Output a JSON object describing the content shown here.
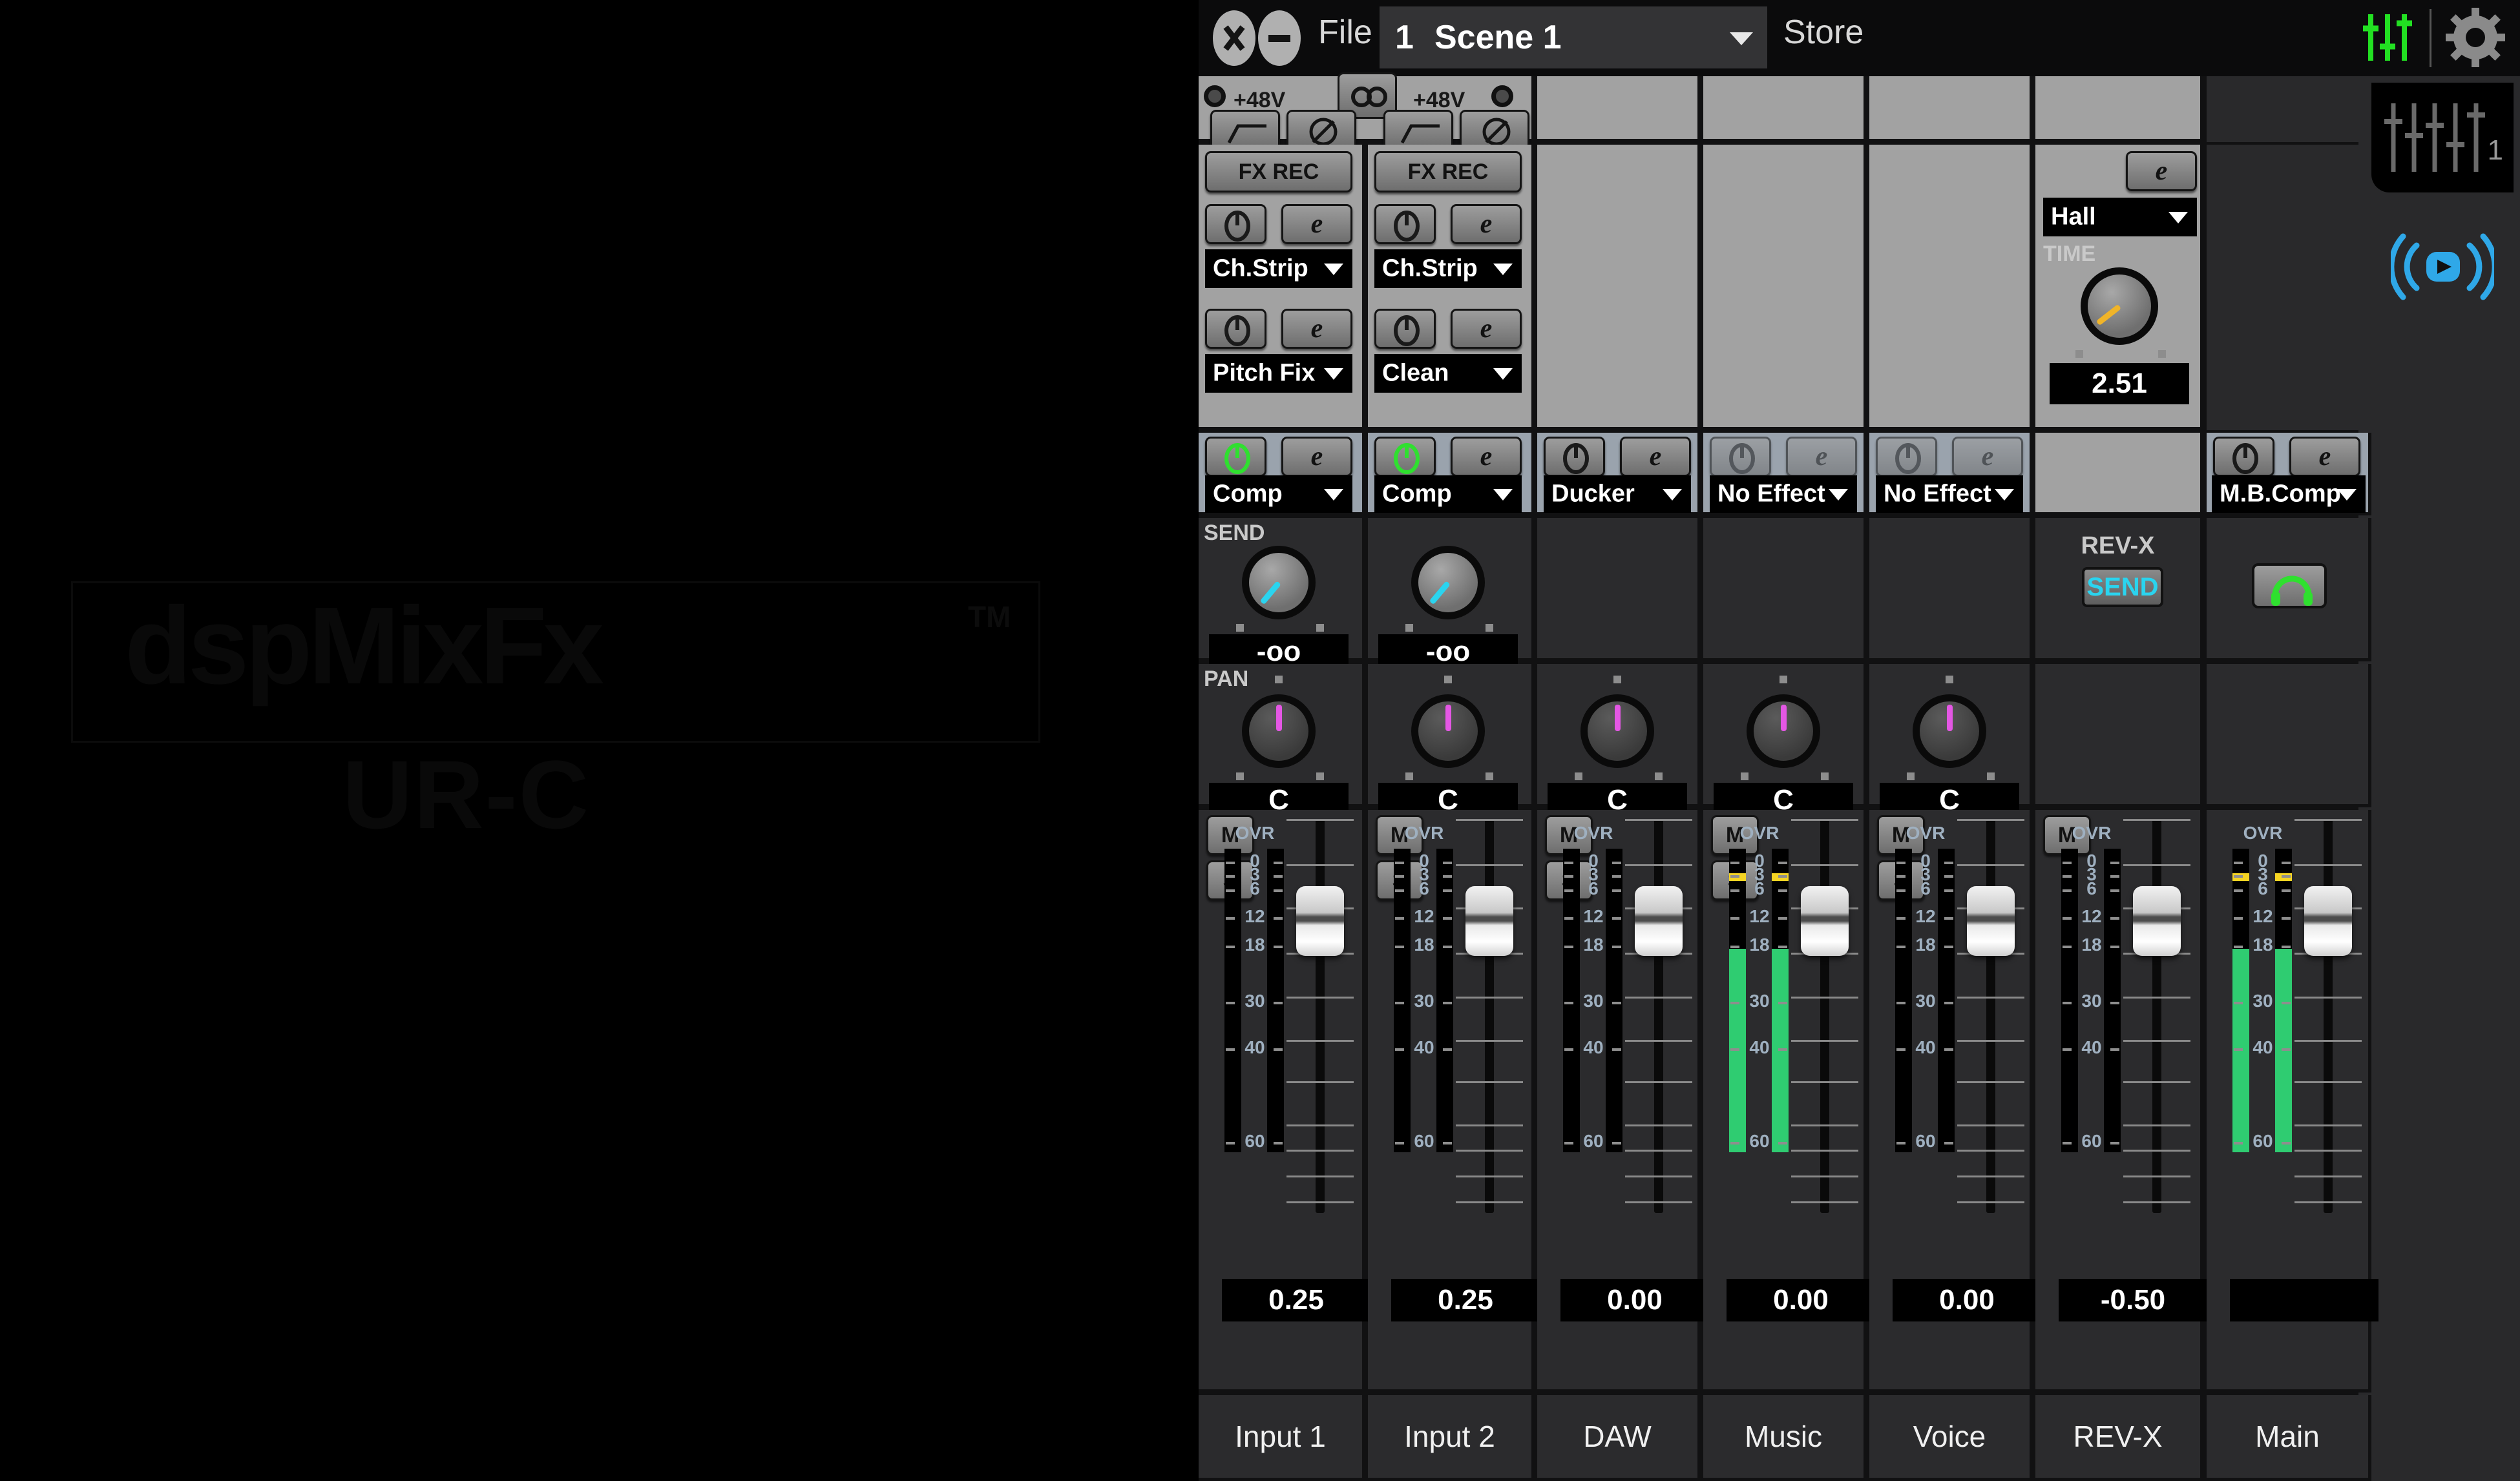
{
  "app": {
    "logo_text": "dspMixFx",
    "logo_tm": "TM",
    "logo_sub": "UR-C"
  },
  "header": {
    "close_icon": "close-icon",
    "minimize_icon": "minimize-icon",
    "file_label": "File",
    "scene_number": "1",
    "scene_name": "Scene 1",
    "store_label": "Store",
    "eq_icon": "faders-icon",
    "gear_icon": "gear-icon"
  },
  "rail": {
    "mixer_tab_number": "1",
    "mixer_tab_icon": "mixer-faders-icon",
    "stream_icon": "broadcast-icon"
  },
  "input_pair": {
    "phantom_left_label": "+48V",
    "phantom_right_label": "+48V",
    "link_icon": "link-icon",
    "hpf_icon": "highpass-filter-icon",
    "phase_icon": "phase-invert-icon"
  },
  "channels": [
    {
      "name": "Input 1",
      "fx_rec_label": "FX REC",
      "chstrip_value": "Ch.Strip",
      "chstrip_on": false,
      "amp_value": "Pitch Fix",
      "amp_on": false,
      "effect_value": "Comp",
      "effect_on": true,
      "effect_enabled": true,
      "send_label": "SEND",
      "send_value": "-oo",
      "send_angle": -140,
      "pan_label": "PAN",
      "pan_value": "C",
      "pan_angle": 0,
      "mute_label": "M",
      "solo_label": "S",
      "fader_value": "0.25",
      "meter_stereo": false,
      "meter_db": -99,
      "peak_db": null
    },
    {
      "name": "Input 2",
      "fx_rec_label": "FX REC",
      "chstrip_value": "Ch.Strip",
      "chstrip_on": false,
      "amp_value": "Clean",
      "amp_on": false,
      "effect_value": "Comp",
      "effect_on": true,
      "effect_enabled": true,
      "send_value": "-oo",
      "send_angle": -140,
      "pan_value": "C",
      "pan_angle": 0,
      "mute_label": "M",
      "solo_label": "S",
      "fader_value": "0.25",
      "meter_stereo": false,
      "meter_db": -99,
      "peak_db": null
    },
    {
      "name": "DAW",
      "effect_value": "Ducker",
      "effect_on": false,
      "effect_enabled": true,
      "pan_value": "C",
      "pan_angle": 0,
      "mute_label": "M",
      "solo_label": "S",
      "fader_value": "0.00",
      "meter_stereo": false,
      "meter_db": -99,
      "peak_db": null
    },
    {
      "name": "Music",
      "effect_value": "No Effect",
      "effect_on": false,
      "effect_enabled": false,
      "pan_value": "C",
      "pan_angle": 0,
      "mute_label": "M",
      "solo_label": "S",
      "fader_value": "0.00",
      "meter_stereo": true,
      "meter_db": -18.5,
      "peak_db": -2.2
    },
    {
      "name": "Voice",
      "effect_value": "No Effect",
      "effect_on": false,
      "effect_enabled": false,
      "pan_value": "C",
      "pan_angle": 0,
      "mute_label": "M",
      "solo_label": "S",
      "fader_value": "0.00",
      "meter_stereo": false,
      "meter_db": -99,
      "peak_db": null
    },
    {
      "name": "REV-X",
      "reverb_type": "Hall",
      "reverb_time_label": "TIME",
      "reverb_time_value": "2.51",
      "reverb_time_angle": -128,
      "return_label": "REV-X",
      "send_button_label": "SEND",
      "mute_label": "M",
      "fader_value": "-0.50",
      "meter_stereo": true,
      "meter_db": -99,
      "peak_db": null
    },
    {
      "name": "Main",
      "effect_value": "M.B.Comp",
      "effect_on": false,
      "effect_enabled": true,
      "headphone_icon": "headphone-icon",
      "meter_stereo": true,
      "meter_db": -18.5,
      "peak_db": -2.2
    }
  ],
  "meter_scale": [
    "OVR",
    "0",
    "3",
    "6",
    "12",
    "18",
    "30",
    "40",
    "60"
  ],
  "colors": {
    "accent_green": "#2fe02f",
    "accent_cyan": "#2ad4ef",
    "accent_magenta": "#e457e4",
    "accent_amber": "#f0b429",
    "meter_green": "#2fcc71",
    "meter_yellow": "#f5d423",
    "panel_light": "#a2a2a2",
    "panel_dark": "#333335"
  }
}
